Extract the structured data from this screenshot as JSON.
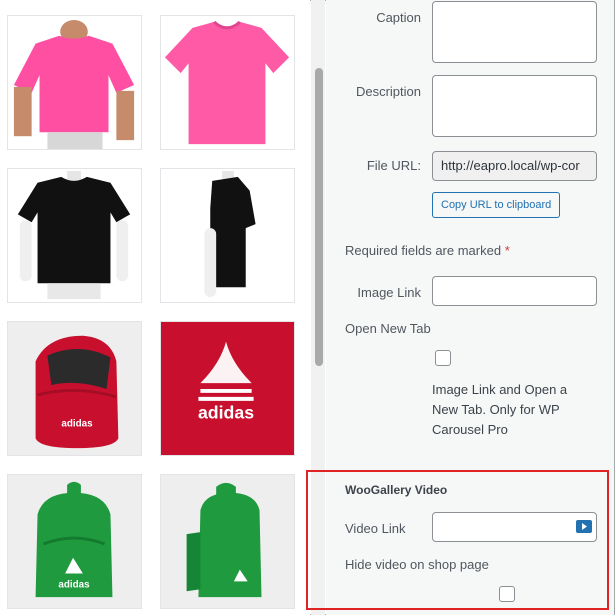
{
  "details": {
    "caption_label": "Caption",
    "description_label": "Description",
    "file_url_label": "File URL:",
    "file_url_value": "http://eapro.local/wp-cor",
    "copy_button": "Copy URL to clipboard",
    "required_text": "Required fields are marked",
    "required_mark": "*",
    "image_link_label": "Image Link",
    "open_new_tab_label": "Open New Tab",
    "image_link_help": "Image Link and Open a New Tab. Only for WP Carousel Pro"
  },
  "woogallery": {
    "title": "WooGallery Video",
    "video_link_label": "Video Link",
    "hide_video_label": "Hide video on shop page"
  },
  "media_items": [
    {
      "name": "pink-tshirt-back",
      "color": "#ff4fa3"
    },
    {
      "name": "pink-tshirt-front",
      "color": "#ff5aa5"
    },
    {
      "name": "black-tshirt-front",
      "color": "#111111"
    },
    {
      "name": "black-tshirt-side",
      "color": "#111111"
    },
    {
      "name": "red-backpack-open",
      "color": "#c8102e"
    },
    {
      "name": "red-backpack-logo",
      "color": "#c8102e",
      "logo_text": "adidas"
    },
    {
      "name": "green-backpack-front",
      "color": "#1f9a3e",
      "logo_text": "adidas"
    },
    {
      "name": "green-backpack-side",
      "color": "#1f9a3e"
    }
  ],
  "colors": {
    "highlight": "#e02424",
    "accent": "#2271b1",
    "required": "#d63638"
  }
}
